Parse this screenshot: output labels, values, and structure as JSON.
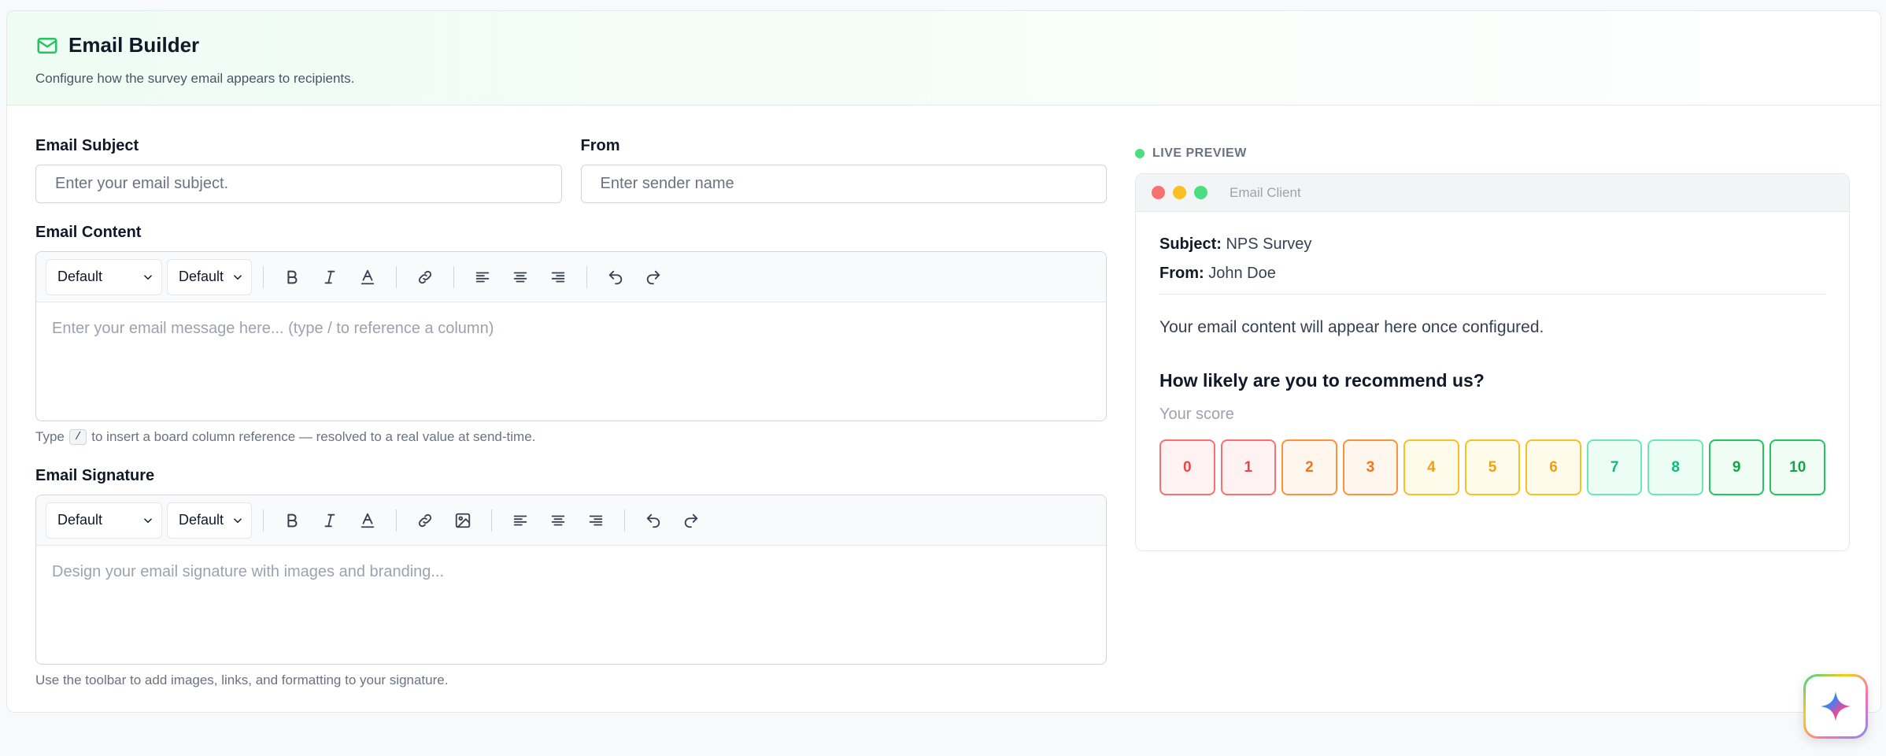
{
  "header": {
    "title": "Email Builder",
    "subtitle": "Configure how the survey email appears to recipients."
  },
  "form": {
    "subject_label": "Email Subject",
    "subject_placeholder": "Enter your email subject.",
    "from_label": "From",
    "from_placeholder": "Enter sender name",
    "content_label": "Email Content",
    "content_placeholder": "Enter your email message here... (type / to reference a column)",
    "content_hint_before": "Type",
    "content_hint_key": "/",
    "content_hint_after": "to insert a board column reference — resolved to a real value at send-time.",
    "signature_label": "Email Signature",
    "signature_placeholder": "Design your email signature with images and branding...",
    "signature_hint": "Use the toolbar to add images, links, and formatting to your signature.",
    "font_select": "Default",
    "size_select": "Default"
  },
  "preview": {
    "label": "LIVE PREVIEW",
    "client_title": "Email Client",
    "subject_key": "Subject:",
    "subject_value": "NPS Survey",
    "from_key": "From:",
    "from_value": "John Doe",
    "content_text": "Your email content will appear here once configured.",
    "question": "How likely are you to recommend us?",
    "score_label": "Your score",
    "scores": [
      "0",
      "1",
      "2",
      "3",
      "4",
      "5",
      "6",
      "7",
      "8",
      "9",
      "10"
    ]
  },
  "colors": {
    "brand": "#22c55e",
    "red_border": "#f87171",
    "red_bg": "#fef2f2",
    "red_text": "#ef4444",
    "orange_border": "#fb923c",
    "orange_bg": "#fff7ed",
    "orange_text": "#f97316",
    "yellow_border": "#fbbf24",
    "yellow_bg": "#fffbeb",
    "yellow_text": "#f59e0b",
    "teal_border": "#6ee7b7",
    "teal_bg": "#ecfdf5",
    "teal_text": "#10b981",
    "green_border": "#22c55e",
    "green_bg": "#f0fdf4",
    "green_text": "#16a34a"
  }
}
